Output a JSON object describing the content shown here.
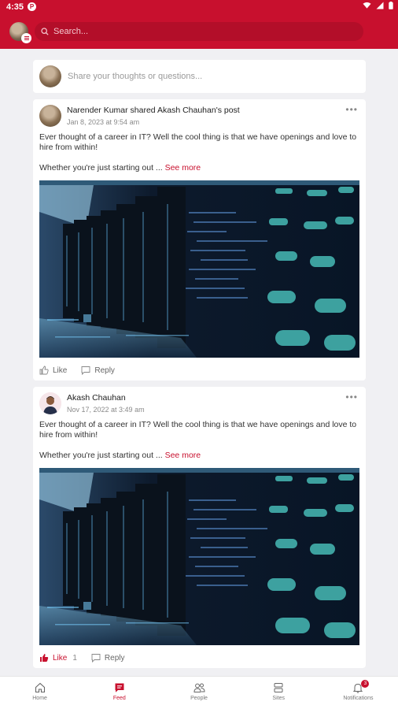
{
  "status_bar": {
    "time": "4:35",
    "app_badge": "P"
  },
  "header": {
    "search_placeholder": "Search..."
  },
  "composer": {
    "prompt": "Share your thoughts or questions..."
  },
  "posts": [
    {
      "author": "Narender Kumar shared Akash Chauhan's post",
      "date": "Jan 8, 2023 at 9:54 am",
      "text": " Ever thought of a career in IT?  Well the cool thing is that we have openings and love to hire from within!",
      "text2": "Whether you're just starting out ...",
      "see_more": "See more",
      "like_label": "Like",
      "like_count": "",
      "reply_label": "Reply",
      "liked": false
    },
    {
      "author": "Akash Chauhan",
      "date": "Nov 17, 2022 at 3:49 am",
      "text": " Ever thought of a career in IT?  Well the cool thing is that we have openings and love to hire from within!",
      "text2": "Whether you're just starting out ...",
      "see_more": "See more",
      "like_label": "Like",
      "like_count": "1",
      "reply_label": "Reply",
      "liked": true
    }
  ],
  "bottom_nav": [
    {
      "label": "Home",
      "icon": "home-icon"
    },
    {
      "label": "Feed",
      "icon": "feed-icon",
      "active": true
    },
    {
      "label": "People",
      "icon": "people-icon"
    },
    {
      "label": "Sites",
      "icon": "sites-icon"
    },
    {
      "label": "Notifications",
      "icon": "bell-icon",
      "badge": "3"
    }
  ],
  "colors": {
    "brand": "#c8102e",
    "background": "#f0f0f3"
  }
}
